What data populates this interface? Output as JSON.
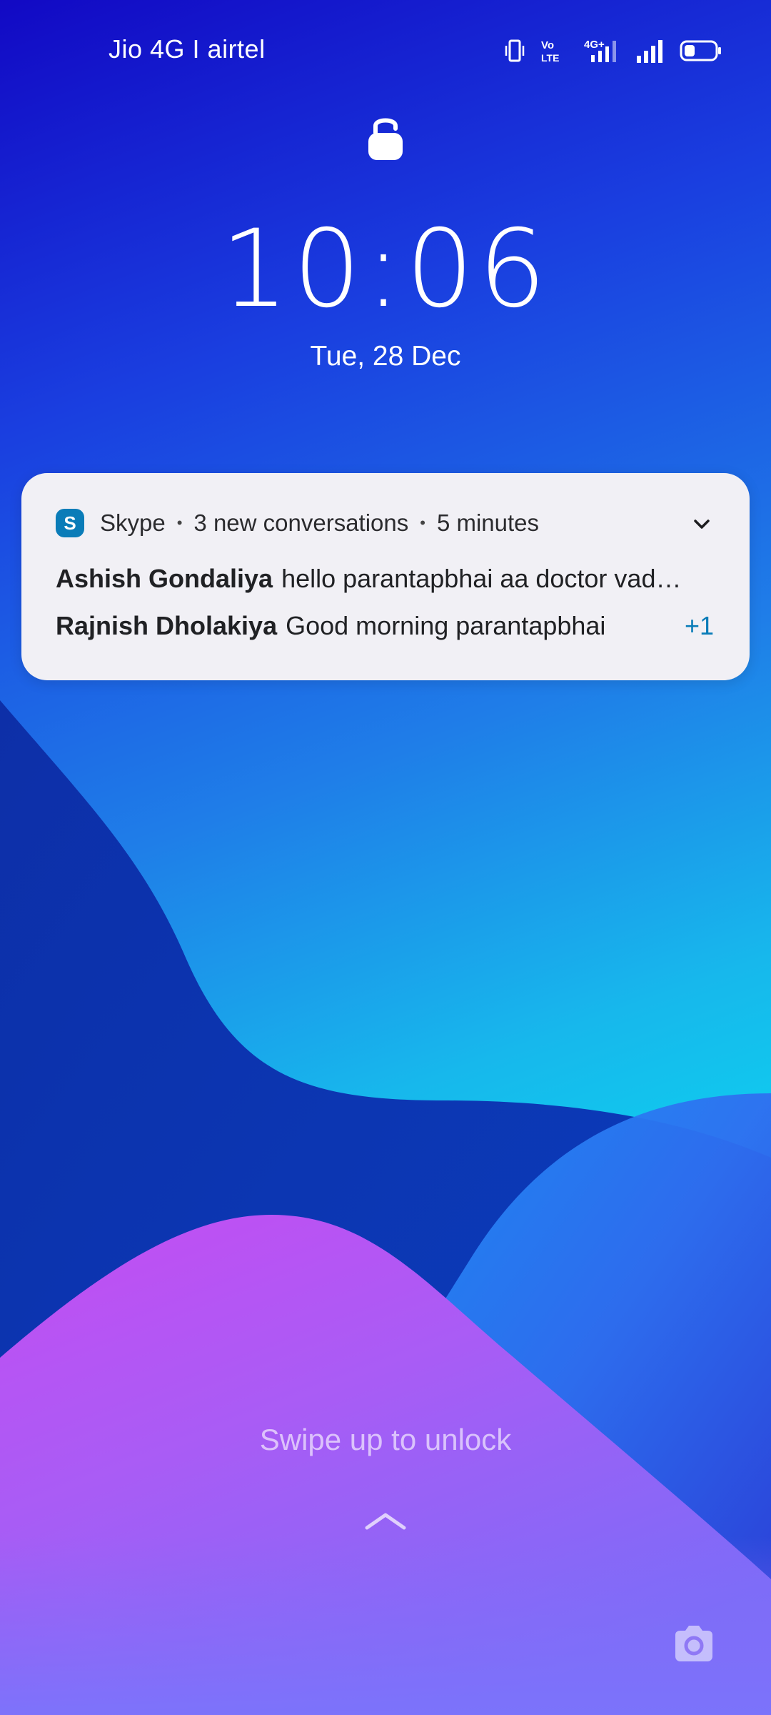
{
  "status_bar": {
    "carrier": "Jio 4G I airtel",
    "icons": [
      "vibrate-icon",
      "volte-icon",
      "4g-plus-icon",
      "signal-icon",
      "battery-icon"
    ],
    "network_label": "4G+",
    "volte_label_top": "Vo",
    "volte_label_bottom": "LTE",
    "battery_level": 0.35
  },
  "lock_screen": {
    "time": "10:06",
    "date": "Tue, 28 Dec",
    "swipe_hint": "Swipe up to unlock"
  },
  "notification": {
    "app_name": "Skype",
    "summary": "3 new conversations",
    "time_ago": "5 minutes",
    "accent_color": "#0a7cb8",
    "messages": [
      {
        "sender": "Ashish Gondaliya",
        "text": "hello parantapbhai aa doctor vad…"
      },
      {
        "sender": "Rajnish Dholakiya",
        "text": "Good morning parantapbhai"
      }
    ],
    "more_count": "+1"
  },
  "colors": {
    "card_background": "#f1f0f5",
    "wallpaper_top": "#1209c4",
    "wallpaper_cyan": "#10c9ee",
    "wallpaper_purple": "#b54cf0"
  }
}
